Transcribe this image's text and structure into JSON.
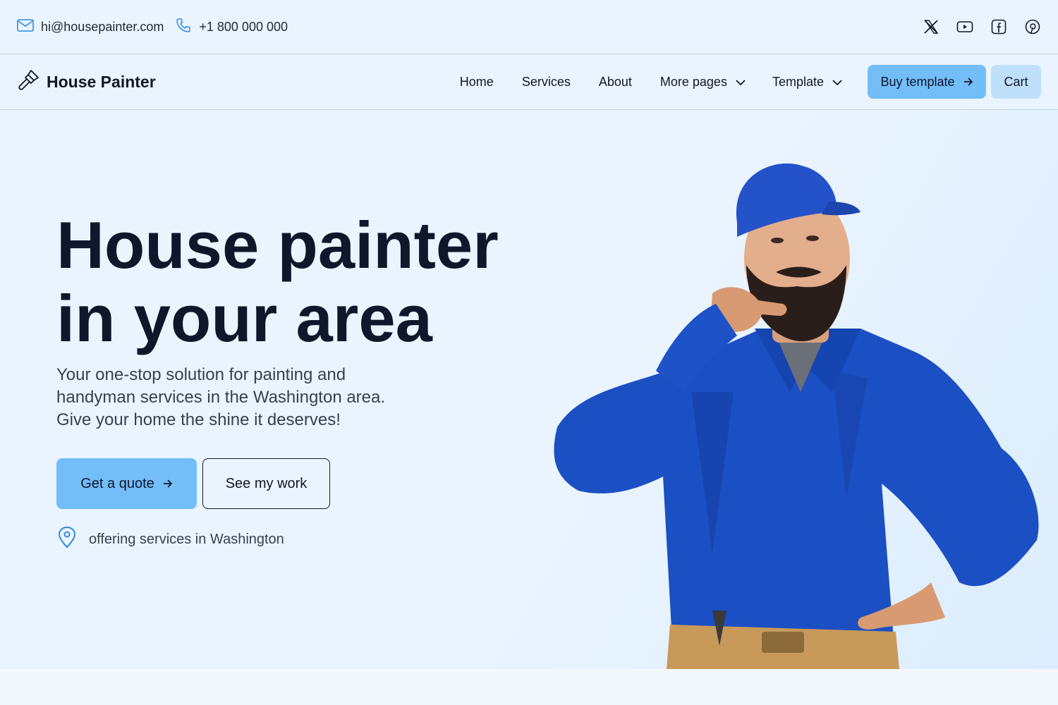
{
  "topbar": {
    "email": "hi@housepainter.com",
    "phone": "+1 800 000 000",
    "social_icons": [
      "x-icon",
      "youtube-icon",
      "facebook-icon",
      "pinterest-icon"
    ]
  },
  "navbar": {
    "brand": "House Painter",
    "links": [
      "Home",
      "Services",
      "About"
    ],
    "more_pages": "More pages",
    "template": "Template",
    "buy_template": "Buy template",
    "cart": "Cart"
  },
  "hero": {
    "headline_line1": "House painter",
    "headline_line2": "in your area",
    "subheading": "Your one-stop solution for painting and handyman services in the Washington area. Give your home the shine it deserves!",
    "cta_primary": "Get a quote",
    "cta_secondary": "See my work",
    "location_text": "offering services in Washington"
  },
  "colors": {
    "background": "#eaf4fe",
    "accent": "#73bdf9",
    "accent_light": "#bfe0fb",
    "text": "#111827"
  }
}
